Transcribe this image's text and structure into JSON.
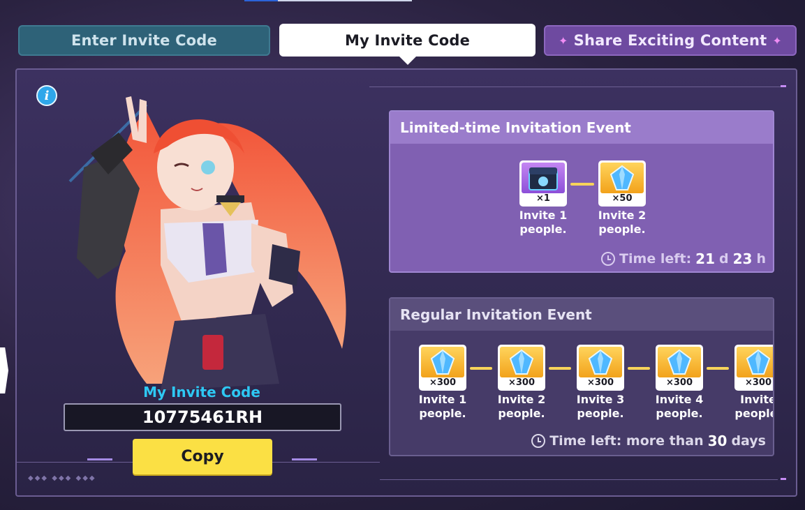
{
  "tabs": {
    "enter": "Enter Invite Code",
    "mine": "My Invite Code",
    "share": "Share Exciting Content",
    "share_sparkle": "✦"
  },
  "invite": {
    "label": "My Invite Code",
    "code": "10775461RH",
    "copy_label": "Copy"
  },
  "limited_event": {
    "title": "Limited-time Invitation Event",
    "rewards": [
      {
        "qty": "×1",
        "line1": "Invite 1",
        "line2": "people.",
        "icon": "treasure-chest-icon"
      },
      {
        "qty": "×50",
        "line1": "Invite 2",
        "line2": "people.",
        "icon": "crystal-icon"
      }
    ],
    "time_prefix": "Time left: ",
    "days": "21",
    "d": " d ",
    "hours": "23",
    "h": " h"
  },
  "regular_event": {
    "title": "Regular Invitation Event",
    "rewards": [
      {
        "qty": "×300",
        "line1": "Invite 1",
        "line2": "people.",
        "icon": "crystal-icon"
      },
      {
        "qty": "×300",
        "line1": "Invite 2",
        "line2": "people.",
        "icon": "crystal-icon"
      },
      {
        "qty": "×300",
        "line1": "Invite 3",
        "line2": "people.",
        "icon": "crystal-icon"
      },
      {
        "qty": "×300",
        "line1": "Invite 4",
        "line2": "people.",
        "icon": "crystal-icon"
      },
      {
        "qty": "×300",
        "line1": "Invite",
        "line2": "people.",
        "icon": "crystal-icon"
      }
    ],
    "time_prefix": "Time left: more than ",
    "days": "30",
    "days_suffix": " days"
  },
  "colors": {
    "accent_cyan": "#2ec8f3",
    "copy_yellow": "#fbe044",
    "limited_purple": "#8060b2"
  }
}
